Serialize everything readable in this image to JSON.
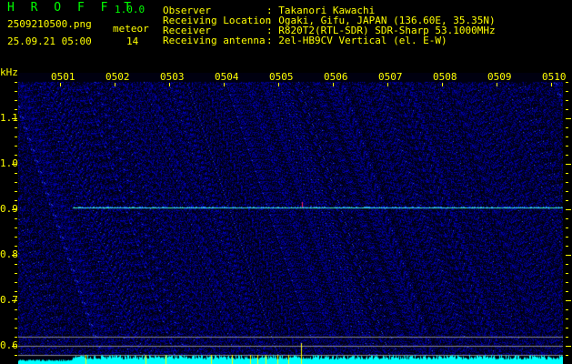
{
  "header": {
    "app_title": "H R O F F T",
    "version": "1.0.0",
    "filename": "2509210500.png",
    "datetime": "25.09.21 05:00",
    "meteor_label": "meteor",
    "meteor_count": "14",
    "info": [
      {
        "label": "Observer",
        "value": ": Takanori Kawachi"
      },
      {
        "label": "Receiving Location",
        "value": ": Ogaki, Gifu, JAPAN (136.60E, 35.35N)"
      },
      {
        "label": "Receiver",
        "value": ": R820T2(RTL-SDR) SDR-Sharp 53.1000MHz"
      },
      {
        "label": "Receiving antenna",
        "value": ": 2el-HB9CV Vertical (el. E-W)"
      }
    ]
  },
  "axis": {
    "unit": "kHz",
    "y_ticks": [
      "1.1",
      "1.0",
      "0.9",
      "0.8",
      "0.7",
      "0.6"
    ],
    "x_ticks": [
      "0501",
      "0502",
      "0503",
      "0504",
      "0505",
      "0506",
      "0507",
      "0508",
      "0509",
      "0510"
    ]
  },
  "colors": {
    "text": "#ffff00",
    "title": "#00ff00",
    "noise": "#1010a0",
    "signal": "#40ffc0",
    "histogram": "#00ffff"
  }
}
